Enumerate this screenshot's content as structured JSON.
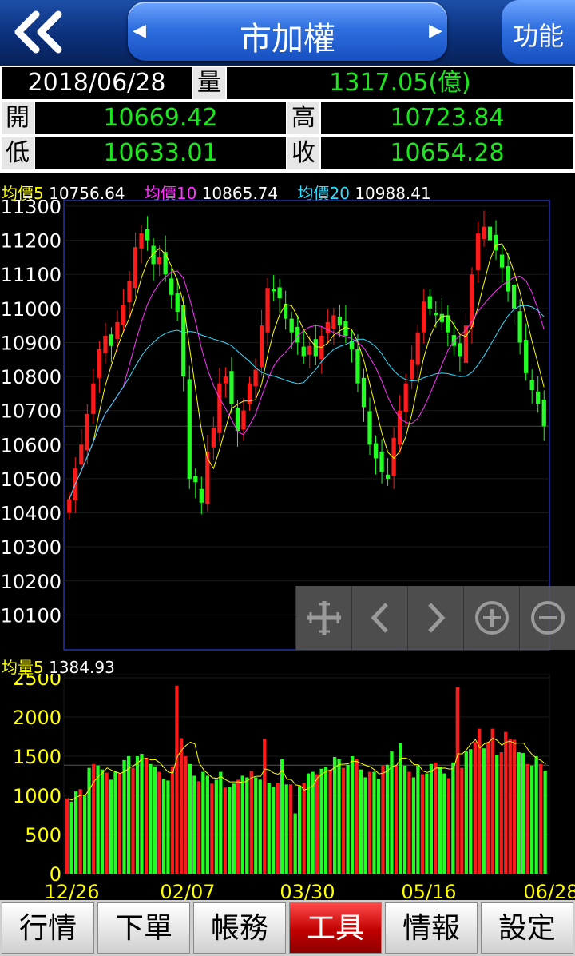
{
  "header": {
    "back_icon": "double-chevron-left-icon",
    "title": "市加權",
    "left_arrow": "◀",
    "right_arrow": "▶",
    "function_label": "功能"
  },
  "info": {
    "date": "2018/06/28",
    "volume_label": "量",
    "volume_value": "1317.05(億)",
    "open_label": "開",
    "open_value": "10669.42",
    "high_label": "高",
    "high_value": "10723.84",
    "low_label": "低",
    "low_value": "10633.01",
    "close_label": "收",
    "close_value": "10654.28"
  },
  "ma_legend": {
    "ma5_label": "均價5",
    "ma5_value": "10756.64",
    "ma10_label": "均價10",
    "ma10_value": "10865.74",
    "ma20_label": "均價20",
    "ma20_value": "10988.41"
  },
  "volume_legend": {
    "label": "均量5",
    "value": "1384.93"
  },
  "colors": {
    "up": "#ff1a1a",
    "down": "#22ff22",
    "ma5": "#ffff00",
    "ma10": "#ff33ff",
    "ma20": "#33ddff",
    "active_tab": "#c00000"
  },
  "chart_data": [
    {
      "type": "candlestick",
      "y_ticks": [
        "11300",
        "11200",
        "11100",
        "11000",
        "10900",
        "10800",
        "10700",
        "10600",
        "10500",
        "10400",
        "10300",
        "10200",
        "10100"
      ],
      "ylim": [
        10000,
        11300
      ],
      "close_values": [
        10440,
        10530,
        10600,
        10690,
        10780,
        10880,
        10920,
        10890,
        10960,
        11010,
        11080,
        11180,
        11220,
        11200,
        11130,
        11150,
        11100,
        11040,
        10990,
        10800,
        10500,
        10490,
        10430,
        10580,
        10650,
        10780,
        10800,
        10720,
        10640,
        10700,
        10780,
        10820,
        10950,
        11060,
        11050,
        11030,
        10970,
        10930,
        10900,
        10860,
        10890,
        10860,
        10920,
        10960,
        10980,
        10950,
        10920,
        10880,
        10780,
        10710,
        10600,
        10560,
        10520,
        10500,
        10620,
        10700,
        10780,
        10850,
        10930,
        11020,
        11000,
        10980,
        10960,
        10930,
        10890,
        10860,
        10950,
        11100,
        11220,
        11240,
        11200,
        11170,
        11120,
        11050,
        11000,
        10900,
        10810,
        10760,
        10720,
        10654
      ],
      "x_tick_labels": [
        "12/26",
        "02/07",
        "03/30",
        "05/16",
        "06/28"
      ]
    },
    {
      "type": "bar",
      "y_ticks": [
        "2500",
        "2000",
        "1500",
        "1000",
        "500",
        "0"
      ],
      "ylim": [
        0,
        2500
      ],
      "values": [
        960,
        920,
        1050,
        1080,
        1000,
        1350,
        1400,
        1380,
        1330,
        1290,
        1200,
        1300,
        1280,
        1450,
        1500,
        1350,
        1500,
        1530,
        1480,
        1400,
        1370,
        1300,
        1210,
        1190,
        1370,
        2400,
        1730,
        1500,
        1400,
        1250,
        1180,
        1300,
        1250,
        1150,
        1200,
        1300,
        1100,
        1110,
        1150,
        1200,
        1250,
        1230,
        1310,
        1230,
        1200,
        1720,
        1160,
        1110,
        1160,
        1460,
        1140,
        1140,
        770,
        1120,
        1160,
        1280,
        1300,
        1270,
        1340,
        1360,
        1330,
        1490,
        1460,
        1350,
        1390,
        1500,
        1460,
        1330,
        1230,
        1300,
        1300,
        1210,
        1380,
        1390,
        1560,
        1380,
        1670,
        1380,
        1300,
        1230,
        1380,
        1270,
        1280,
        1400,
        1420,
        1360,
        1280,
        1220,
        1420,
        2380,
        1350,
        1560,
        1590,
        1680,
        1850,
        1600,
        1680,
        1850,
        1520,
        1550,
        1810,
        1720,
        1710,
        1550,
        1540,
        1400,
        1380,
        1500,
        1400,
        1317
      ],
      "bar_colors": "mixed red/green"
    }
  ],
  "tabs": [
    "行情",
    "下單",
    "帳務",
    "工具",
    "情報",
    "設定"
  ],
  "active_tab": "工具"
}
